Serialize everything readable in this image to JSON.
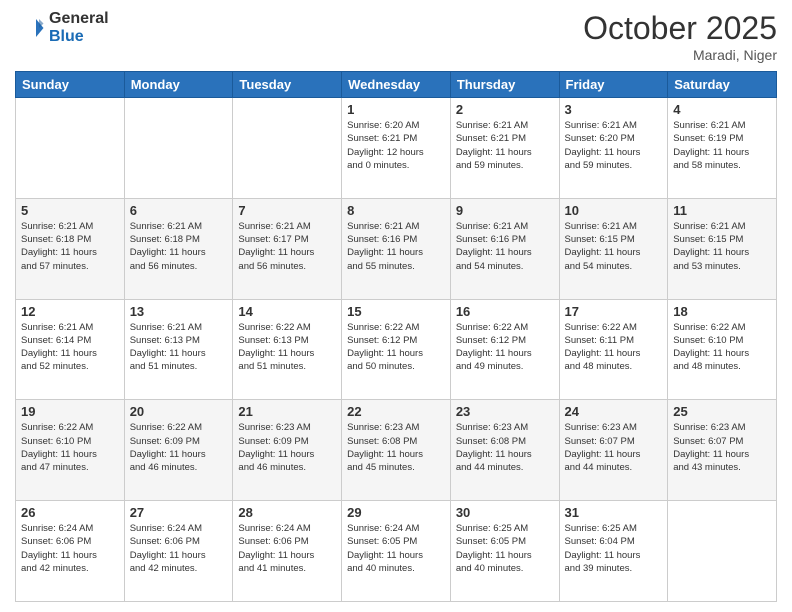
{
  "logo": {
    "general": "General",
    "blue": "Blue"
  },
  "header": {
    "month": "October 2025",
    "location": "Maradi, Niger"
  },
  "days_of_week": [
    "Sunday",
    "Monday",
    "Tuesday",
    "Wednesday",
    "Thursday",
    "Friday",
    "Saturday"
  ],
  "weeks": [
    [
      {
        "day": "",
        "info": ""
      },
      {
        "day": "",
        "info": ""
      },
      {
        "day": "",
        "info": ""
      },
      {
        "day": "1",
        "info": "Sunrise: 6:20 AM\nSunset: 6:21 PM\nDaylight: 12 hours\nand 0 minutes."
      },
      {
        "day": "2",
        "info": "Sunrise: 6:21 AM\nSunset: 6:21 PM\nDaylight: 11 hours\nand 59 minutes."
      },
      {
        "day": "3",
        "info": "Sunrise: 6:21 AM\nSunset: 6:20 PM\nDaylight: 11 hours\nand 59 minutes."
      },
      {
        "day": "4",
        "info": "Sunrise: 6:21 AM\nSunset: 6:19 PM\nDaylight: 11 hours\nand 58 minutes."
      }
    ],
    [
      {
        "day": "5",
        "info": "Sunrise: 6:21 AM\nSunset: 6:18 PM\nDaylight: 11 hours\nand 57 minutes."
      },
      {
        "day": "6",
        "info": "Sunrise: 6:21 AM\nSunset: 6:18 PM\nDaylight: 11 hours\nand 56 minutes."
      },
      {
        "day": "7",
        "info": "Sunrise: 6:21 AM\nSunset: 6:17 PM\nDaylight: 11 hours\nand 56 minutes."
      },
      {
        "day": "8",
        "info": "Sunrise: 6:21 AM\nSunset: 6:16 PM\nDaylight: 11 hours\nand 55 minutes."
      },
      {
        "day": "9",
        "info": "Sunrise: 6:21 AM\nSunset: 6:16 PM\nDaylight: 11 hours\nand 54 minutes."
      },
      {
        "day": "10",
        "info": "Sunrise: 6:21 AM\nSunset: 6:15 PM\nDaylight: 11 hours\nand 54 minutes."
      },
      {
        "day": "11",
        "info": "Sunrise: 6:21 AM\nSunset: 6:15 PM\nDaylight: 11 hours\nand 53 minutes."
      }
    ],
    [
      {
        "day": "12",
        "info": "Sunrise: 6:21 AM\nSunset: 6:14 PM\nDaylight: 11 hours\nand 52 minutes."
      },
      {
        "day": "13",
        "info": "Sunrise: 6:21 AM\nSunset: 6:13 PM\nDaylight: 11 hours\nand 51 minutes."
      },
      {
        "day": "14",
        "info": "Sunrise: 6:22 AM\nSunset: 6:13 PM\nDaylight: 11 hours\nand 51 minutes."
      },
      {
        "day": "15",
        "info": "Sunrise: 6:22 AM\nSunset: 6:12 PM\nDaylight: 11 hours\nand 50 minutes."
      },
      {
        "day": "16",
        "info": "Sunrise: 6:22 AM\nSunset: 6:12 PM\nDaylight: 11 hours\nand 49 minutes."
      },
      {
        "day": "17",
        "info": "Sunrise: 6:22 AM\nSunset: 6:11 PM\nDaylight: 11 hours\nand 48 minutes."
      },
      {
        "day": "18",
        "info": "Sunrise: 6:22 AM\nSunset: 6:10 PM\nDaylight: 11 hours\nand 48 minutes."
      }
    ],
    [
      {
        "day": "19",
        "info": "Sunrise: 6:22 AM\nSunset: 6:10 PM\nDaylight: 11 hours\nand 47 minutes."
      },
      {
        "day": "20",
        "info": "Sunrise: 6:22 AM\nSunset: 6:09 PM\nDaylight: 11 hours\nand 46 minutes."
      },
      {
        "day": "21",
        "info": "Sunrise: 6:23 AM\nSunset: 6:09 PM\nDaylight: 11 hours\nand 46 minutes."
      },
      {
        "day": "22",
        "info": "Sunrise: 6:23 AM\nSunset: 6:08 PM\nDaylight: 11 hours\nand 45 minutes."
      },
      {
        "day": "23",
        "info": "Sunrise: 6:23 AM\nSunset: 6:08 PM\nDaylight: 11 hours\nand 44 minutes."
      },
      {
        "day": "24",
        "info": "Sunrise: 6:23 AM\nSunset: 6:07 PM\nDaylight: 11 hours\nand 44 minutes."
      },
      {
        "day": "25",
        "info": "Sunrise: 6:23 AM\nSunset: 6:07 PM\nDaylight: 11 hours\nand 43 minutes."
      }
    ],
    [
      {
        "day": "26",
        "info": "Sunrise: 6:24 AM\nSunset: 6:06 PM\nDaylight: 11 hours\nand 42 minutes."
      },
      {
        "day": "27",
        "info": "Sunrise: 6:24 AM\nSunset: 6:06 PM\nDaylight: 11 hours\nand 42 minutes."
      },
      {
        "day": "28",
        "info": "Sunrise: 6:24 AM\nSunset: 6:06 PM\nDaylight: 11 hours\nand 41 minutes."
      },
      {
        "day": "29",
        "info": "Sunrise: 6:24 AM\nSunset: 6:05 PM\nDaylight: 11 hours\nand 40 minutes."
      },
      {
        "day": "30",
        "info": "Sunrise: 6:25 AM\nSunset: 6:05 PM\nDaylight: 11 hours\nand 40 minutes."
      },
      {
        "day": "31",
        "info": "Sunrise: 6:25 AM\nSunset: 6:04 PM\nDaylight: 11 hours\nand 39 minutes."
      },
      {
        "day": "",
        "info": ""
      }
    ]
  ]
}
